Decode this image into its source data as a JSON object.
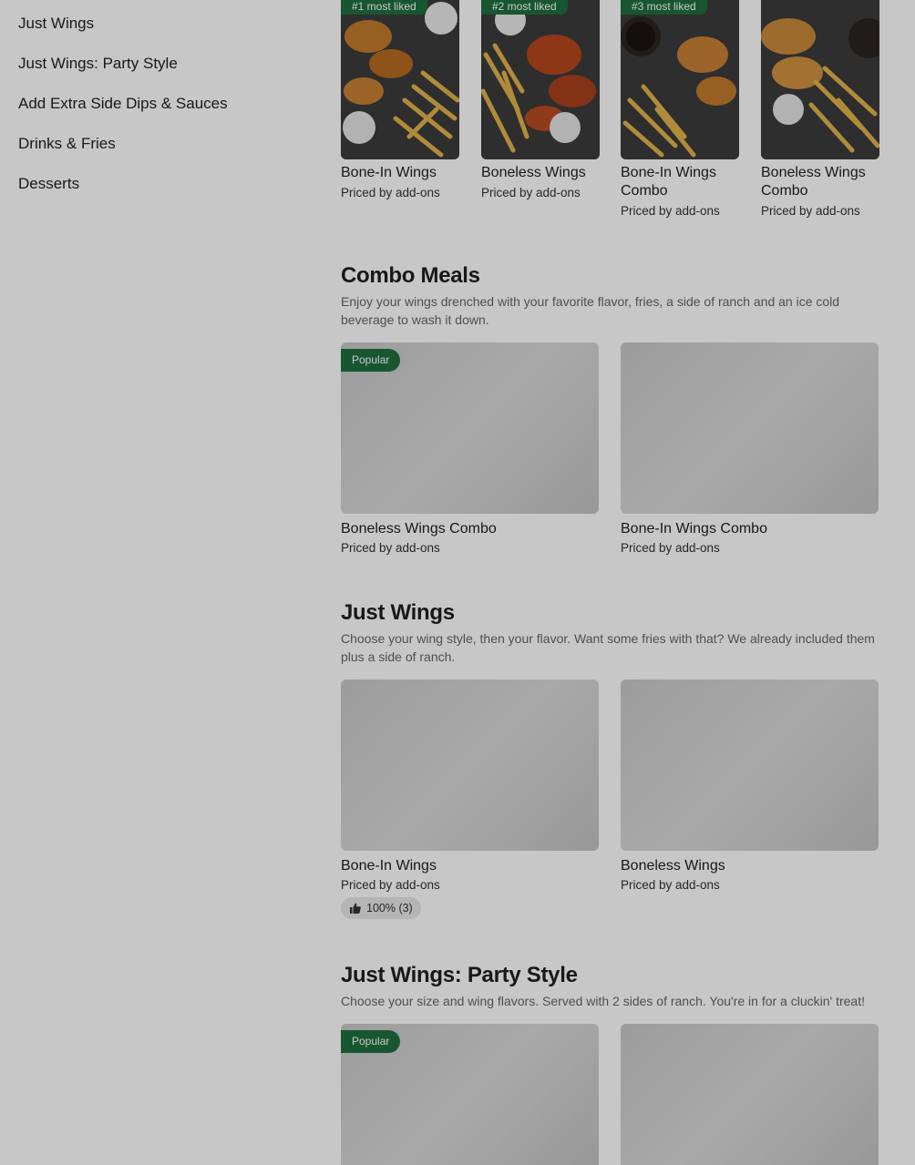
{
  "sidebar": {
    "items": [
      {
        "label": "Just Wings"
      },
      {
        "label": "Just Wings: Party Style"
      },
      {
        "label": "Add Extra Side Dips & Sauces"
      },
      {
        "label": "Drinks & Fries"
      },
      {
        "label": "Desserts"
      }
    ]
  },
  "featured": [
    {
      "badge": "#1 most liked",
      "name": "Bone-In Wings",
      "price": "Priced by add-ons"
    },
    {
      "badge": "#2 most liked",
      "name": "Boneless Wings",
      "price": "Priced by add-ons"
    },
    {
      "badge": "#3 most liked",
      "name": "Bone-In Wings Combo",
      "price": "Priced by add-ons"
    },
    {
      "badge": "",
      "name": "Boneless Wings Combo",
      "price": "Priced by add-ons"
    }
  ],
  "sections": [
    {
      "title": "Combo Meals",
      "desc": "Enjoy your wings drenched with your favorite flavor, fries, a side of ranch and an ice cold beverage to wash it down.",
      "items": [
        {
          "pill": "Popular",
          "name": "Boneless Wings Combo",
          "price": "Priced by add-ons"
        },
        {
          "pill": "",
          "name": "Bone-In Wings Combo",
          "price": "Priced by add-ons"
        }
      ]
    },
    {
      "title": "Just Wings",
      "desc": "Choose your wing style, then your flavor. Want some fries with that? We already included them plus a side of ranch.",
      "items": [
        {
          "pill": "",
          "name": "Bone-In Wings",
          "price": "Priced by add-ons",
          "rating": "100% (3)"
        },
        {
          "pill": "",
          "name": "Boneless Wings",
          "price": "Priced by add-ons"
        }
      ]
    },
    {
      "title": "Just Wings: Party Style",
      "desc": "Choose your size and wing flavors. Served with 2 sides of ranch. You're in for a cluckin' treat!",
      "items": [
        {
          "pill": "Popular"
        },
        {
          "pill": ""
        }
      ]
    }
  ],
  "colors": {
    "accent": "#1f6f3f",
    "overlay": "rgba(0,0,0,0.22)"
  },
  "icons": {
    "rating": "thumbs-up-icon"
  }
}
